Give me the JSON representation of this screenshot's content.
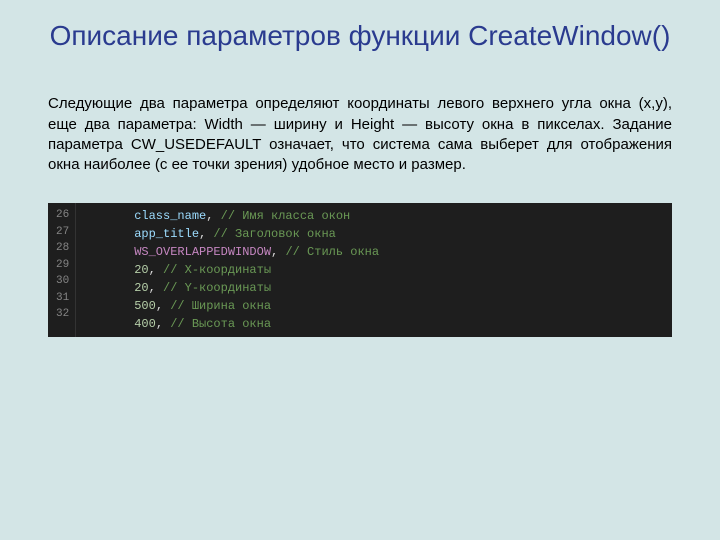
{
  "title": "Описание параметров функции CreateWindow()",
  "paragraph": "Следующие два параметра определяют координаты левого верхнего угла окна (x,y), еще два параметра: Width — ширину и Height — высоту окна в пикселах. Задание параметра CW_USEDEFAULT означает, что система сама выберет для отображения окна наиболее (с ее точки зрения) удобное место и размер.",
  "code": {
    "lines": [
      {
        "num": "26",
        "token": "class_name",
        "tokClass": "tok-var",
        "punct": ",",
        "comment": "// Имя класса окон"
      },
      {
        "num": "27",
        "token": "app_title",
        "tokClass": "tok-var",
        "punct": ",",
        "comment": "// Заголовок окна"
      },
      {
        "num": "28",
        "token": "WS_OVERLAPPEDWINDOW",
        "tokClass": "tok-const",
        "punct": ",",
        "comment": "// Стиль окна"
      },
      {
        "num": "29",
        "token": "20",
        "tokClass": "tok-num",
        "punct": ",",
        "comment": "// X-координаты"
      },
      {
        "num": "30",
        "token": "20",
        "tokClass": "tok-num",
        "punct": ",",
        "comment": "// Y-координаты"
      },
      {
        "num": "31",
        "token": "500",
        "tokClass": "tok-num",
        "punct": ",",
        "comment": "// Ширина окна"
      },
      {
        "num": "32",
        "token": "400",
        "tokClass": "tok-num",
        "punct": ",",
        "comment": "// Высота окна"
      }
    ]
  }
}
